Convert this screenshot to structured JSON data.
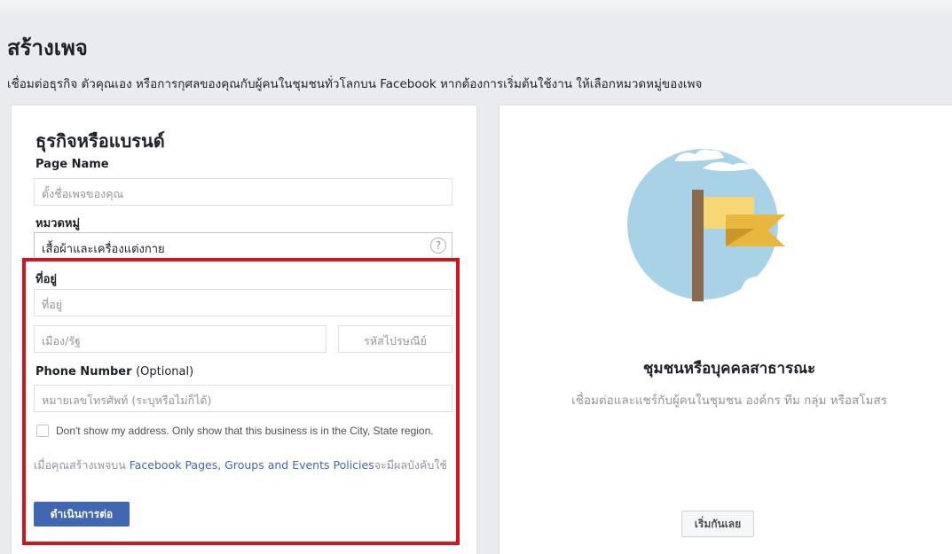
{
  "header": {
    "title": "สร้างเพจ",
    "subtitle": "เชื่อมต่อธุรกิจ ตัวคุณเอง หรือการกุศลของคุณกับผู้คนในชุมชนทั่วโลกบน Facebook หากต้องการเริ่มต้นใช้งาน ให้เลือกหมวดหมู่ของเพจ"
  },
  "business_card": {
    "title": "ธุรกิจหรือแบรนด์",
    "page_name": {
      "label": "Page Name",
      "placeholder": "ตั้งชื่อเพจของคุณ"
    },
    "category": {
      "label": "หมวดหมู่",
      "value": "เสื้อผ้าและเครื่องแต่งกาย",
      "help_icon": "?"
    },
    "address": {
      "label": "ที่อยู่",
      "placeholder": "ที่อยู่",
      "city_placeholder": "เมือง/รัฐ",
      "zip_placeholder": "รหัสไปรษณีย์"
    },
    "phone": {
      "label": "Phone Number",
      "optional": "(Optional)",
      "placeholder": "หมายเลขโทรศัพท์ (ระบุหรือไม่ก็ได้)"
    },
    "hide_address_checkbox": {
      "checked": false,
      "text": "Don't show my address. Only show that this business is in the City, State region."
    },
    "policy": {
      "prefix": "เมื่อคุณสร้างเพจบน ",
      "link": "Facebook Pages, Groups and Events Policies",
      "suffix": "จะมีผลบังคับใช้"
    },
    "continue_button": "ดำเนินการต่อ",
    "highlight_color": "#d0151f"
  },
  "community_card": {
    "title": "ชุมชนหรือบุคคลสาธารณะ",
    "description": "เชื่อมต่อและแชร์กับผู้คนในชุมชน องค์กร ทีม กลุ่ม หรือสโมสร",
    "start_button": "เริ่มกันเลย",
    "illustration": "flag-icon"
  },
  "colors": {
    "background": "#e9ebee",
    "primary_button": "#4267b2",
    "link": "#4267b2",
    "illustration_circle": "#a8d3e7",
    "flag": "#f7d775"
  }
}
